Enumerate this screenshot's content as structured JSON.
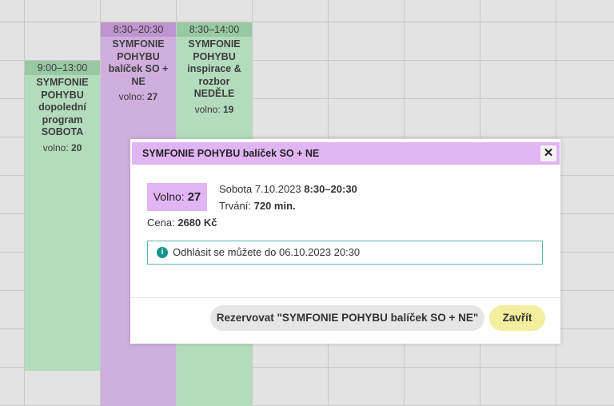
{
  "calendar": {
    "events": [
      {
        "time": "9:00–13:00",
        "title": "SYMFONIE POHYBU dopolední program SOBOTA",
        "free_label": "volno:",
        "free_count": "20",
        "color": "#b3dcbc"
      },
      {
        "time": "8:30–20:30",
        "title": "SYMFONIE POHYBU balíček SO + NE",
        "free_label": "volno:",
        "free_count": "27",
        "color": "#d0aede"
      },
      {
        "time": "8:30–14:00",
        "title": "SYMFONIE POHYBU inspirace & rozbor NEDĚLE",
        "free_label": "volno:",
        "free_count": "19",
        "color": "#b3dcbc"
      }
    ]
  },
  "modal": {
    "title": "SYMFONIE POHYBU balíček SO + NE",
    "close_icon": "✕",
    "free_label": "Volno:",
    "free_count": "27",
    "date_text": "Sobota 7.10.2023",
    "time_range": "8:30–20:30",
    "duration_label": "Trvání:",
    "duration_value": "720 min.",
    "price_label": "Cena:",
    "price_value": "2680 Kč",
    "alert_icon": "i",
    "alert_text": "Odhlásit se můžete do 06.10.2023 20:30",
    "reserve_button": "Rezervovat \"SYMFONIE POHYBU balíček SO + NE\"",
    "close_button": "Zavřít"
  },
  "colors": {
    "accent_purple": "#e1b4f3",
    "info_teal": "#16938d",
    "close_yellow": "#f3ef9e"
  }
}
